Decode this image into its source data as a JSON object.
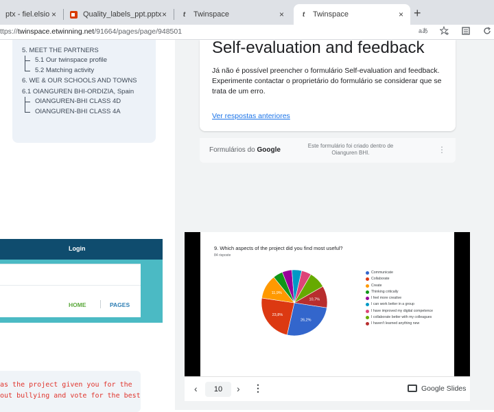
{
  "browser": {
    "tabs": [
      {
        "title": "ptx - fiel.elsio",
        "icon": "document-icon",
        "active": false
      },
      {
        "title": "Quality_labels_ppt.pptx",
        "icon": "office-icon",
        "active": false
      },
      {
        "title": "Twinspace",
        "icon": "twinspace-icon",
        "active": false
      },
      {
        "title": "Twinspace",
        "icon": "twinspace-icon",
        "active": true
      }
    ],
    "close_glyph": "×",
    "new_tab_glyph": "+",
    "url_grey": "ttps://",
    "url_main": "twinspace.etwinning.net",
    "url_path": "/91664/pages/page/948501",
    "toolbar_icons": [
      "read-aloud-icon",
      "favorite-icon",
      "collections-icon",
      "refresh-icon"
    ]
  },
  "sidebar": {
    "items": [
      {
        "text": "5. MEET THE PARTNERS",
        "type": "section"
      },
      {
        "text": "5.1 Our twinspace profile",
        "type": "sub"
      },
      {
        "text": "5.2 Matching activity",
        "type": "sub-last"
      },
      {
        "text": "6. WE & OUR SCHOOLS AND TOWNS",
        "type": "section"
      },
      {
        "text": "6.1 OIANGUREN BHI-ORDIZIA, Spain",
        "type": "section"
      },
      {
        "text": "OIANGUREN-BHI CLASS 4D",
        "type": "sub"
      },
      {
        "text": "OIANGUREN-BHI CLASS 4A",
        "type": "sub-last"
      }
    ]
  },
  "embed_site": {
    "login_label": "Login",
    "home_label": "HOME",
    "pages_label": "PAGES"
  },
  "red_note": {
    "line1": "as the project given you for the",
    "line2": "out bullying and vote for the best"
  },
  "form": {
    "title": "Self-evaluation and feedback",
    "message": "Já não é possível preencher o formulário Self-evaluation and feedback. Experimente contactar o proprietário do formulário se considerar que se trata de um erro.",
    "link": "Ver respostas anteriores",
    "footer_prefix": "Formulários do",
    "footer_brand": "Google",
    "footer_note": "Este formulário foi criado dentro de Oianguren BHI.",
    "more_glyph": "⋮"
  },
  "slides": {
    "question": "9. Which aspects of the project did you find most useful?",
    "responses": "84 risposte",
    "page_number": "10",
    "prev_glyph": "‹",
    "next_glyph": "›",
    "more_glyph": "⋮",
    "brand": "Google Slides"
  },
  "chart_data": {
    "type": "pie",
    "title": "9. Which aspects of the project did you find most useful?",
    "subtitle": "84 risposte",
    "categories": [
      "Communicate",
      "Collaborate",
      "Create",
      "Thinking critically",
      "I feel more creative",
      "I can work better in a group",
      "I have improved my digital competence",
      "I collaborate better with my colleagues",
      "I haven't learned anything new"
    ],
    "values": [
      26.2,
      23.8,
      11.9,
      4.8,
      4.8,
      4.8,
      4.8,
      8.3,
      10.7
    ],
    "data_labels": [
      "26,2%",
      "23,8%",
      "11,9%",
      "",
      "",
      "",
      "",
      "",
      "10,7%"
    ],
    "colors": [
      "#3366cc",
      "#dc3912",
      "#ff9900",
      "#109618",
      "#990099",
      "#0099c6",
      "#dd4477",
      "#66aa00",
      "#b82e2e"
    ],
    "legend_position": "right"
  }
}
